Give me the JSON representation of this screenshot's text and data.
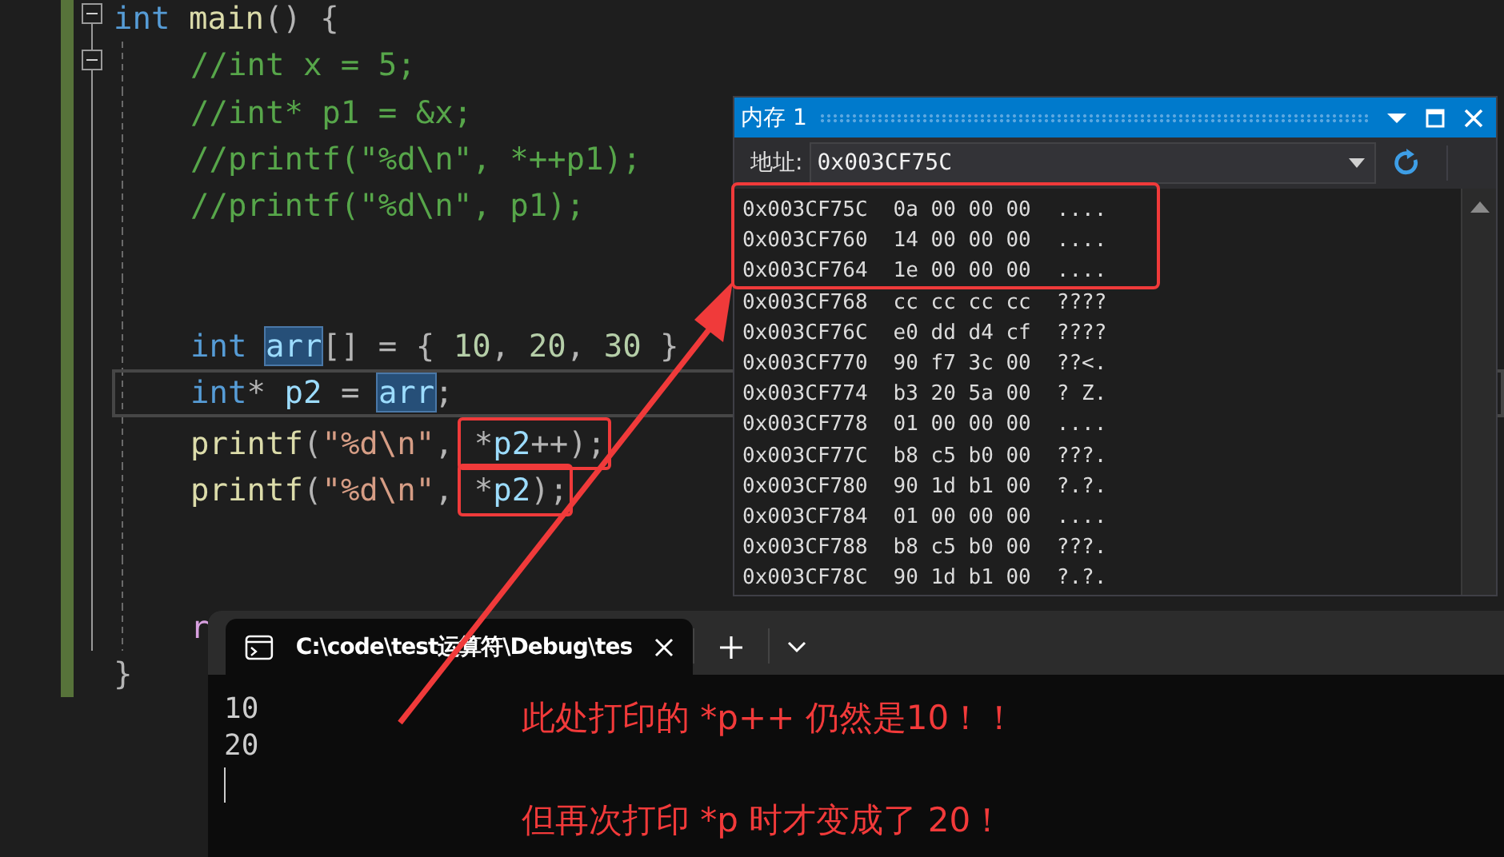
{
  "editor": {
    "lines": [
      {
        "kind": "code",
        "collapsible": true,
        "current": false,
        "tokens": [
          {
            "text": "int ",
            "kind": "kw"
          },
          {
            "text": "main",
            "kind": "fn"
          },
          {
            "text": "() {",
            "kind": "p"
          }
        ],
        "children": [
          {
            "kind": "code",
            "collapsible": true,
            "current": false,
            "tokens": [
              {
                "text": "//int x = 5;",
                "kind": "cm"
              }
            ]
          },
          {
            "kind": "code",
            "collapsible": false,
            "current": false,
            "tokens": [
              {
                "text": "//int* p1 = &x;",
                "kind": "cm"
              }
            ]
          },
          {
            "kind": "code",
            "collapsible": false,
            "current": false,
            "tokens": [
              {
                "text": "//printf(\"%d\\n\", *++p1);",
                "kind": "cm"
              }
            ]
          },
          {
            "kind": "code",
            "collapsible": false,
            "current": false,
            "tokens": [
              {
                "text": "//printf(\"%d\\n\", p1);",
                "kind": "cm"
              }
            ]
          },
          {
            "kind": "blank"
          },
          {
            "kind": "blank"
          },
          {
            "kind": "code",
            "collapsible": false,
            "current": false,
            "tokens": [
              {
                "text": "int ",
                "kind": "kw"
              },
              {
                "text": "arr",
                "kind": "hl"
              },
              {
                "text": "[] = { ",
                "kind": "p"
              },
              {
                "text": "10",
                "kind": "num"
              },
              {
                "text": ", ",
                "kind": "p"
              },
              {
                "text": "20",
                "kind": "num"
              },
              {
                "text": ", ",
                "kind": "p"
              },
              {
                "text": "30",
                "kind": "num"
              },
              {
                "text": " }",
                "kind": "p"
              }
            ]
          },
          {
            "kind": "code",
            "collapsible": false,
            "current": true,
            "tokens": [
              {
                "text": "int",
                "kind": "kw"
              },
              {
                "text": "* ",
                "kind": "p"
              },
              {
                "text": "p2",
                "kind": "id"
              },
              {
                "text": " = ",
                "kind": "p"
              },
              {
                "text": "arr",
                "kind": "hl"
              },
              {
                "text": ";",
                "kind": "p"
              }
            ]
          },
          {
            "kind": "code",
            "collapsible": false,
            "current": false,
            "tokens": [
              {
                "text": "printf",
                "kind": "fn",
                "boxed": false
              },
              {
                "text": "(",
                "kind": "p",
                "boxed": false
              },
              {
                "text": "\"%d\\n\"",
                "kind": "str",
                "boxed": false
              },
              {
                "text": ",",
                "kind": "p",
                "boxed": false
              },
              {
                "text": "*",
                "kind": "p",
                "boxed": true
              },
              {
                "text": "p2",
                "kind": "id",
                "boxed": true
              },
              {
                "text": "++);",
                "kind": "p",
                "boxed": true
              }
            ]
          },
          {
            "kind": "code",
            "collapsible": false,
            "current": false,
            "tokens": [
              {
                "text": "printf",
                "kind": "fn",
                "boxed": false
              },
              {
                "text": "(",
                "kind": "p",
                "boxed": false
              },
              {
                "text": "\"%d\\n\"",
                "kind": "str",
                "boxed": false
              },
              {
                "text": ",",
                "kind": "p",
                "boxed": false
              },
              {
                "text": "*",
                "kind": "p",
                "boxed": true
              },
              {
                "text": "p2",
                "kind": "id",
                "boxed": true
              },
              {
                "text": ");",
                "kind": "p",
                "boxed": true
              }
            ]
          },
          {
            "kind": "blank"
          },
          {
            "kind": "blank"
          },
          {
            "kind": "code",
            "collapsible": false,
            "current": false,
            "tokens": [
              {
                "text": "r",
                "kind": "ctl"
              }
            ]
          }
        ]
      },
      {
        "kind": "code",
        "collapsible": false,
        "current": false,
        "tokens": [
          {
            "text": "}",
            "kind": "p"
          }
        ]
      }
    ]
  },
  "memory_window": {
    "title": "内存 1",
    "address_label": "地址:",
    "address": "0x003CF75C",
    "rows": [
      {
        "address": "0x003CF75C",
        "bytes": "0a 00 00 00",
        "chars": "...."
      },
      {
        "address": "0x003CF760",
        "bytes": "14 00 00 00",
        "chars": "...."
      },
      {
        "address": "0x003CF764",
        "bytes": "1e 00 00 00",
        "chars": "...."
      },
      {
        "address": "0x003CF768",
        "bytes": "cc cc cc cc",
        "chars": "????"
      },
      {
        "address": "0x003CF76C",
        "bytes": "e0 dd d4 cf",
        "chars": "????"
      },
      {
        "address": "0x003CF770",
        "bytes": "90 f7 3c 00",
        "chars": "??<."
      },
      {
        "address": "0x003CF774",
        "bytes": "b3 20 5a 00",
        "chars": "? Z."
      },
      {
        "address": "0x003CF778",
        "bytes": "01 00 00 00",
        "chars": "...."
      },
      {
        "address": "0x003CF77C",
        "bytes": "b8 c5 b0 00",
        "chars": "???."
      },
      {
        "address": "0x003CF780",
        "bytes": "90 1d b1 00",
        "chars": "?.?."
      },
      {
        "address": "0x003CF784",
        "bytes": "01 00 00 00",
        "chars": "...."
      },
      {
        "address": "0x003CF788",
        "bytes": "b8 c5 b0 00",
        "chars": "???."
      },
      {
        "address": "0x003CF78C",
        "bytes": "90 1d b1 00",
        "chars": "?.?."
      }
    ]
  },
  "terminal": {
    "tab_title": "C:\\code\\test运算符\\Debug\\tes",
    "output": [
      "10",
      "20"
    ]
  },
  "annotations": [
    "此处打印的 *p++ 仍然是10！！",
    "但再次打印 *p 时才变成了 20！"
  ]
}
